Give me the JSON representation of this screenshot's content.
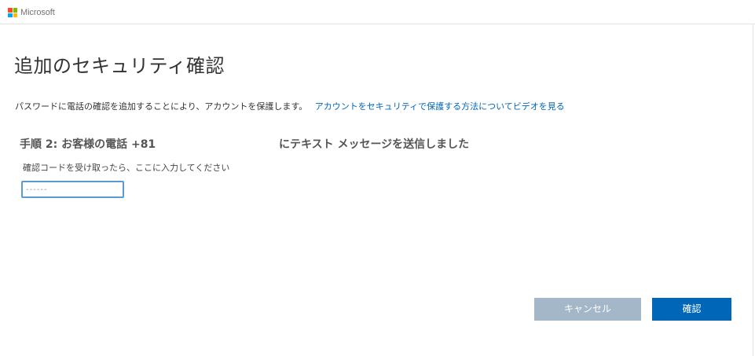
{
  "header": {
    "brand": "Microsoft"
  },
  "colors": {
    "logo_red": "#f25022",
    "logo_green": "#7fba00",
    "logo_blue": "#00a4ef",
    "logo_yellow": "#ffb900",
    "link": "#0067b8",
    "primary_button": "#0067b8",
    "disabled_button": "#a4b7c8"
  },
  "main": {
    "title": "追加のセキュリティ確認",
    "intro_text": "パスワードに電話の確認を追加することにより、アカウントを保護します。",
    "intro_link": "アカウントをセキュリティで保護する方法についてビデオを見る",
    "step_heading": "手順 2: お客様の電話 +81",
    "step_heading_suffix": "にテキスト メッセージを送信しました",
    "code_label": "確認コードを受け取ったら、ここに入力してください",
    "code_input": {
      "value": "",
      "placeholder": "------"
    }
  },
  "actions": {
    "cancel_label": "キャンセル",
    "confirm_label": "確認"
  }
}
